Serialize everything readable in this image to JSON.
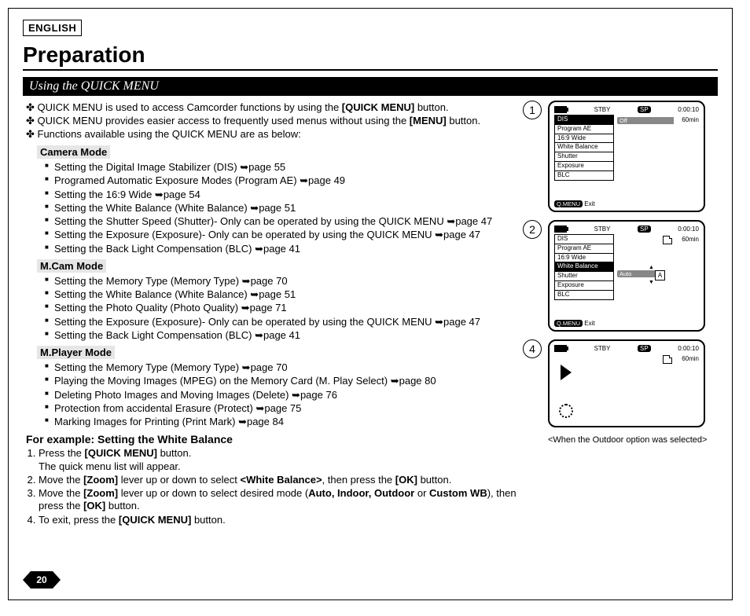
{
  "lang": "ENGLISH",
  "title": "Preparation",
  "section": "Using the QUICK MENU",
  "intro": {
    "l1a": "QUICK MENU is used to access Camcorder functions by using the ",
    "l1b": "[QUICK MENU]",
    "l1c": " button.",
    "l2a": "QUICK MENU provides easier access to frequently used menus without using the ",
    "l2b": "[MENU]",
    "l2c": " button.",
    "l3": "Functions available using the QUICK MENU are as below:"
  },
  "modes": {
    "camera": {
      "label": "Camera Mode",
      "items": [
        {
          "t": "Setting the Digital Image Stabilizer (DIS) ",
          "ref": "➥page 55"
        },
        {
          "t": "Programed Automatic Exposure Modes (Program AE) ",
          "ref": "➥page 49"
        },
        {
          "t": "Setting the 16:9 Wide ",
          "ref": "➥page 54"
        },
        {
          "t": "Setting the White Balance (White Balance) ",
          "ref": "➥page 51"
        },
        {
          "t": "Setting the Shutter Speed (Shutter)- Only can be operated by using the QUICK MENU ",
          "ref": "➥page 47"
        },
        {
          "t": "Setting the Exposure (Exposure)- Only can be operated by using the QUICK MENU ",
          "ref": "➥page 47"
        },
        {
          "t": "Setting the Back Light Compensation (BLC) ",
          "ref": "➥page 41"
        }
      ]
    },
    "mcam": {
      "label": "M.Cam Mode",
      "items": [
        {
          "t": "Setting the Memory Type (Memory Type) ",
          "ref": "➥page 70"
        },
        {
          "t": "Setting the White Balance (White Balance) ",
          "ref": "➥page 51"
        },
        {
          "t": "Setting the Photo Quality (Photo Quality) ",
          "ref": "➥page 71"
        },
        {
          "t": "Setting the Exposure (Exposure)- Only can be operated by using the QUICK MENU ",
          "ref": "➥page 47"
        },
        {
          "t": "Setting the Back Light Compensation (BLC) ",
          "ref": "➥page 41"
        }
      ]
    },
    "mplayer": {
      "label": "M.Player Mode",
      "items": [
        {
          "t": "Setting the Memory Type (Memory Type) ",
          "ref": "➥page 70"
        },
        {
          "t": "Playing the Moving Images (MPEG) on the Memory Card (M. Play Select) ",
          "ref": "➥page 80"
        },
        {
          "t": "Deleting Photo Images and Moving Images (Delete) ",
          "ref": "➥page 76"
        },
        {
          "t": "Protection from accidental Erasure (Protect) ",
          "ref": "➥page 75"
        },
        {
          "t": "Marking Images for Printing (Print Mark) ",
          "ref": "➥page 84"
        }
      ]
    }
  },
  "example": {
    "heading": "For example: Setting the White Balance",
    "s1a": "Press the ",
    "s1b": "[QUICK MENU]",
    "s1c": " button.",
    "s1sub": "The quick menu list will appear.",
    "s2a": "Move the ",
    "s2b": "[Zoom]",
    "s2c": " lever up or down to select ",
    "s2d": "<White Balance>",
    "s2e": ", then press the ",
    "s2f": "[OK]",
    "s2g": " button.",
    "s3a": "Move the ",
    "s3b": "[Zoom]",
    "s3c": " lever up or down to select desired mode (",
    "s3d": "Auto, Indoor, Outdoor",
    "s3e": " or ",
    "s3f": "Custom WB",
    "s3g": "), then press the ",
    "s3h": "[OK]",
    "s3i": " button.",
    "s4a": "To exit, press the ",
    "s4b": "[QUICK MENU]",
    "s4c": " button."
  },
  "page_number": "20",
  "screens": {
    "common": {
      "stby": "STBY",
      "sp": "SP",
      "time": "0:00:10",
      "mins": "60min",
      "qmenu": "Q.MENU",
      "exit": "Exit"
    },
    "menu_items": [
      "DIS",
      "Program AE",
      "16:9 Wide",
      "White Balance",
      "Shutter",
      "Exposure",
      "BLC"
    ],
    "panel1": {
      "num": "1",
      "selected_index": 0,
      "value": "Off"
    },
    "panel2": {
      "num": "2",
      "selected_index": 3,
      "value": "Auto",
      "value_badge": "A"
    },
    "panel4": {
      "num": "4"
    },
    "caption": "<When the Outdoor option was selected>"
  }
}
